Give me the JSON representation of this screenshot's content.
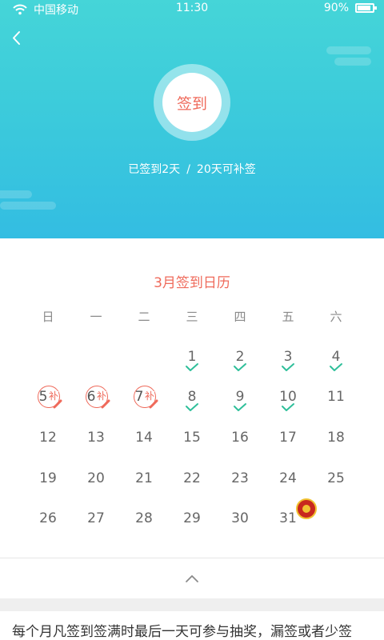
{
  "status_bar": {
    "carrier": "中国移动",
    "time": "11:30",
    "battery": "90%",
    "battery_level": 0.9
  },
  "sign": {
    "button_label": "签到",
    "signed_days": "已签到2天",
    "separator": "/",
    "makeup_days": "20天可补签"
  },
  "calendar": {
    "title": "3月签到日历",
    "weekdays": [
      "日",
      "一",
      "二",
      "三",
      "四",
      "五",
      "六"
    ],
    "makeup_label": "补",
    "days": [
      {
        "label": "1",
        "signed": true
      },
      {
        "label": "2",
        "signed": true
      },
      {
        "label": "3",
        "signed": true
      },
      {
        "label": "4",
        "signed": true
      },
      {
        "label": "5",
        "makeup": true
      },
      {
        "label": "6",
        "makeup": true
      },
      {
        "label": "7",
        "makeup": true
      },
      {
        "label": "8",
        "signed": true
      },
      {
        "label": "9",
        "signed": true
      },
      {
        "label": "10",
        "signed": true
      },
      {
        "label": "11"
      },
      {
        "label": "12"
      },
      {
        "label": "13"
      },
      {
        "label": "14"
      },
      {
        "label": "15"
      },
      {
        "label": "16"
      },
      {
        "label": "17"
      },
      {
        "label": "18"
      },
      {
        "label": "19"
      },
      {
        "label": "20"
      },
      {
        "label": "21"
      },
      {
        "label": "22"
      },
      {
        "label": "23"
      },
      {
        "label": "24"
      },
      {
        "label": "25"
      },
      {
        "label": "26"
      },
      {
        "label": "27"
      },
      {
        "label": "28"
      },
      {
        "label": "29"
      },
      {
        "label": "30"
      },
      {
        "label": "31",
        "prize": true
      }
    ]
  },
  "rules": {
    "text": "每个月凡签到签满时最后一天可参与抽奖，漏签或者少签"
  },
  "colors": {
    "accent": "#ef6a5b",
    "check": "#2fbf9a",
    "header_top": "#45d5d8",
    "header_bottom": "#33bde2"
  }
}
